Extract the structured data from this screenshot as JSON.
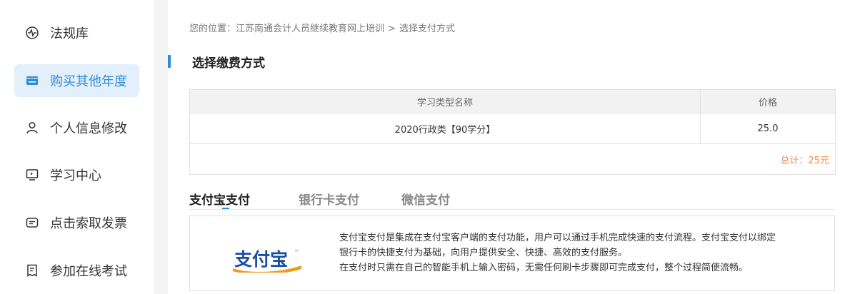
{
  "sidebar": {
    "items": [
      {
        "label": "法规库",
        "icon": "pulse-icon"
      },
      {
        "label": "购买其他年度",
        "icon": "card-icon",
        "active": true
      },
      {
        "label": "个人信息修改",
        "icon": "user-icon"
      },
      {
        "label": "学习中心",
        "icon": "monitor-icon"
      },
      {
        "label": "点击索取发票",
        "icon": "invoice-icon"
      },
      {
        "label": "参加在线考试",
        "icon": "exam-icon"
      }
    ]
  },
  "breadcrumb": {
    "prefix": "您的位置：",
    "site": "江苏南通会计人员继续教育网上培训",
    "separator": ">",
    "current": "选择支付方式"
  },
  "section": {
    "title": "选择缴费方式"
  },
  "table": {
    "headers": [
      "学习类型名称",
      "价格"
    ],
    "rows": [
      [
        "2020行政类【90学分】",
        "25.0"
      ]
    ],
    "total": "总计：25元"
  },
  "tabs": [
    {
      "label": "支付宝支付",
      "active": true
    },
    {
      "label": "银行卡支付",
      "active": false
    },
    {
      "label": "微信支付",
      "active": false
    }
  ],
  "payment": {
    "logo_text": "支付宝",
    "logo_tm": "™",
    "lines": [
      "支付宝支付是集成在支付宝客户端的支付功能，用户可以通过手机完成快速的支付流程。支付宝支付以绑定",
      "银行卡的快捷支付为基础，向用户提供安全、快捷、高效的支付服务。",
      "在支付时只需在自己的智能手机上输入密码，无需任何刷卡步骤即可完成支付，整个过程简便流畅。"
    ]
  },
  "colors": {
    "accent": "#2f8ad8",
    "total": "#f08a4b",
    "logo_blue": "#1a4fa0",
    "logo_orange": "#f39a1e"
  }
}
